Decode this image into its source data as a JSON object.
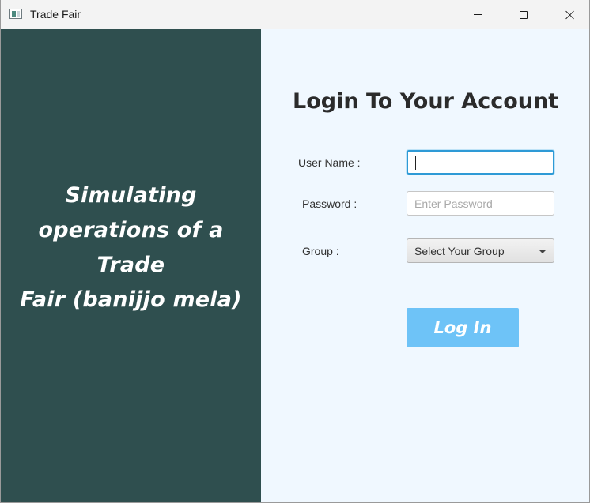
{
  "window": {
    "title": "Trade Fair",
    "buttons": {
      "minimize": "minimize",
      "maximize": "maximize",
      "close": "close"
    }
  },
  "left_panel": {
    "tagline_lines": [
      "Simulating",
      "operations of a Trade",
      "Fair (banijjo mela)"
    ],
    "background": "#2f4f4f"
  },
  "login": {
    "title": "Login To Your Account",
    "username_label": "User Name :",
    "username_value": "",
    "password_label": "Password :",
    "password_placeholder": "Enter Password",
    "password_value": "",
    "group_label": "Group :",
    "group_selected": "Select Your Group",
    "login_button": "Log In",
    "accent_color": "#6ec3f7",
    "background": "#f0f8ff"
  },
  "icons": {
    "app": "app-window-icon",
    "dropdown": "chevron-down-icon"
  }
}
